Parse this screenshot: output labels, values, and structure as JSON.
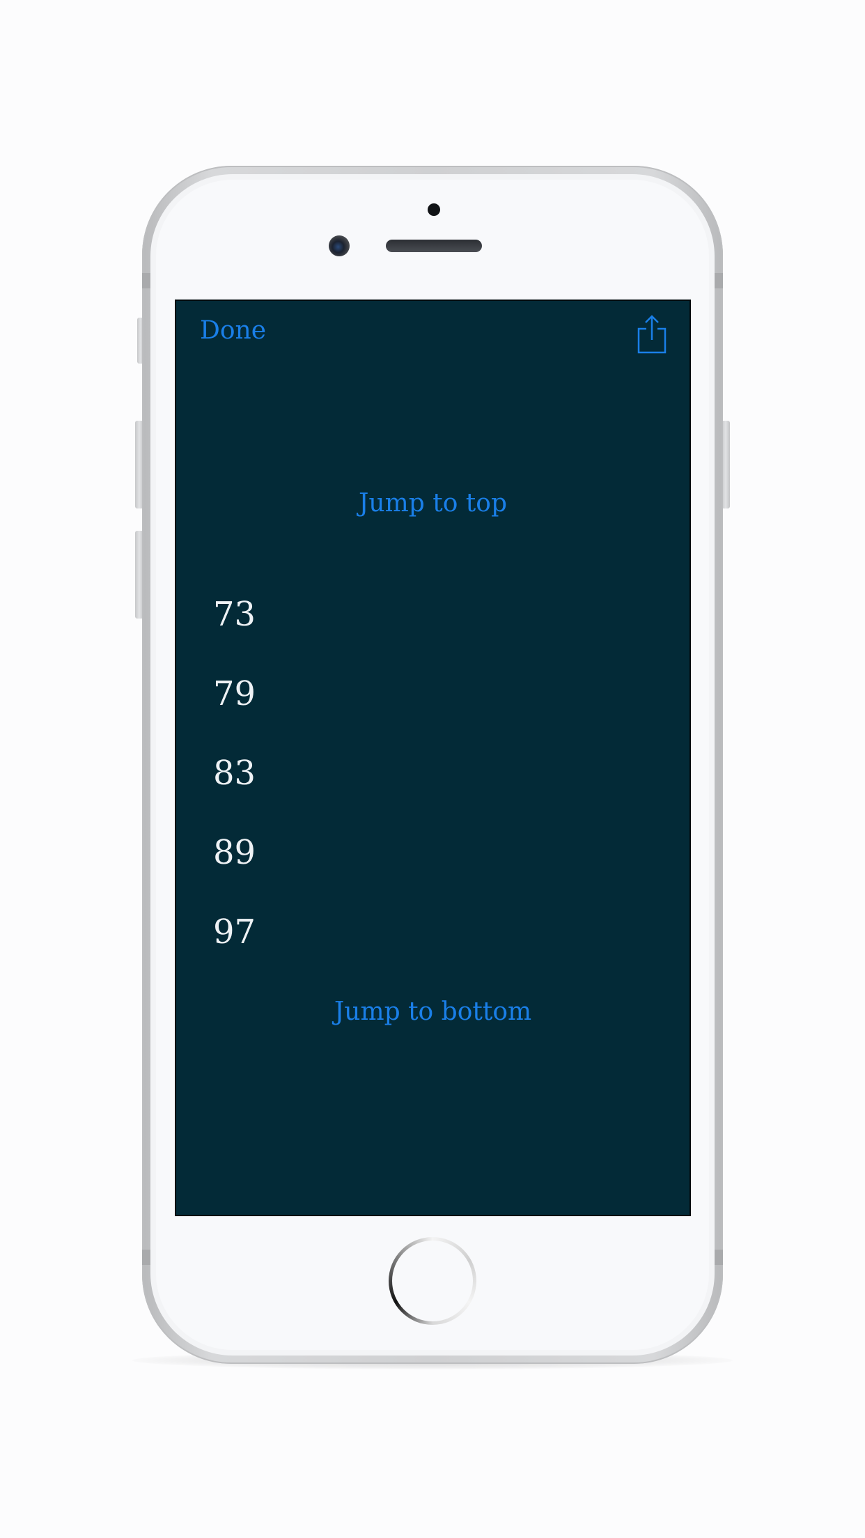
{
  "nav": {
    "done_label": "Done",
    "share_icon": "share-icon"
  },
  "content": {
    "jump_top_label": "Jump to top",
    "numbers": [
      "73",
      "79",
      "83",
      "89",
      "97"
    ],
    "jump_bottom_label": "Jump to bottom"
  },
  "colors": {
    "screen_background": "#032a37",
    "accent": "#1a7fe8",
    "number_text": "#eef2f5"
  }
}
